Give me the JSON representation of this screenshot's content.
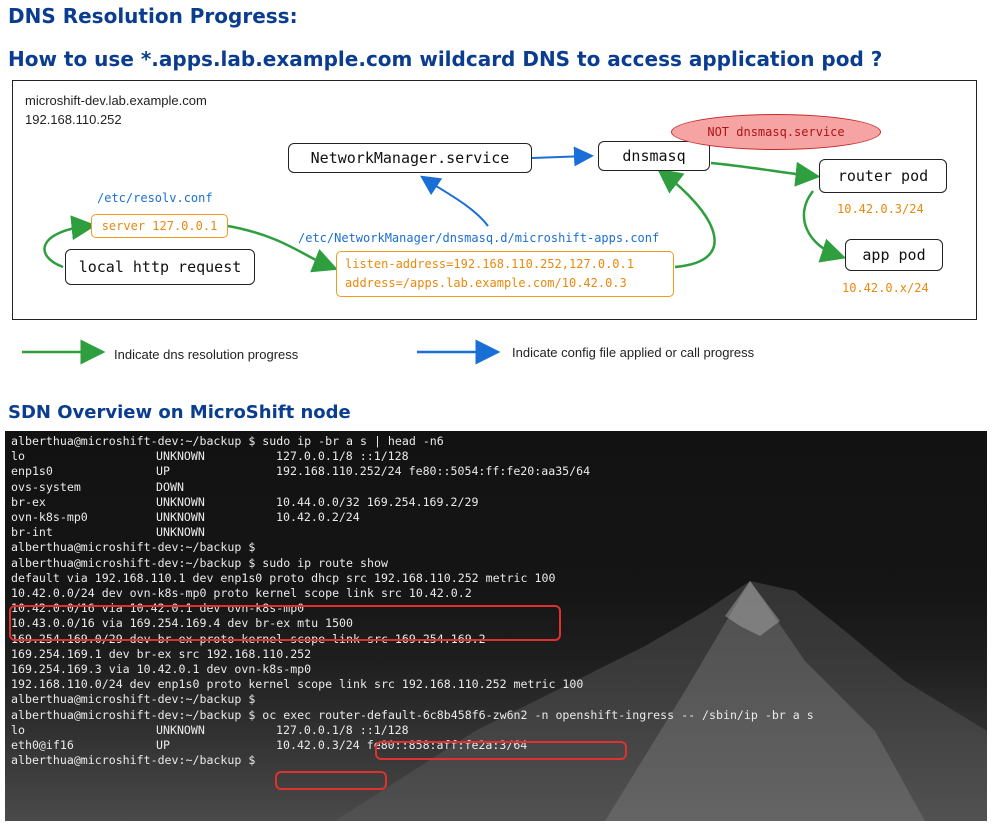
{
  "titles": {
    "main": "DNS Resolution Progress:",
    "question": "How to use *.apps.lab.example.com wildcard DNS to access application pod ?",
    "sdn": "SDN Overview on MicroShift node"
  },
  "diagram": {
    "host_name": "microshift-dev.lab.example.com",
    "host_ip": "192.168.110.252",
    "networkmanager": "NetworkManager.service",
    "dnsmasq": "dnsmasq",
    "not_service": "NOT dnsmasq.service",
    "router_pod": "router pod",
    "router_ip": "10.42.0.3/24",
    "app_pod": "app pod",
    "app_ip": "10.42.0.x/24",
    "resolv_path": "/etc/resolv.conf",
    "resolv_server": "server 127.0.0.1",
    "local_request": "local http request",
    "config_path": "/etc/NetworkManager/dnsmasq.d/microshift-apps.conf",
    "config_line1": "listen-address=192.168.110.252,127.0.0.1",
    "config_line2": "address=/apps.lab.example.com/10.42.0.3",
    "colors": {
      "dns_flow": "#2e9e3e",
      "config_flow": "#1a6fd6",
      "config_text": "#e8890c",
      "highlight": "#e03030"
    }
  },
  "legend": {
    "green": "Indicate dns resolution progress",
    "blue": "Indicate config file applied or call progress"
  },
  "terminal": {
    "lines": [
      {
        "c": [
          "alberthua@microshift-dev:~/backup $ sudo ip -br a s | head -n6"
        ]
      },
      {
        "c": [
          "lo",
          "UNKNOWN",
          "127.0.0.1/8 ::1/128"
        ]
      },
      {
        "c": [
          "enp1s0",
          "UP",
          "192.168.110.252/24 fe80::5054:ff:fe20:aa35/64"
        ]
      },
      {
        "c": [
          "ovs-system",
          "DOWN"
        ]
      },
      {
        "c": [
          "br-ex",
          "UNKNOWN",
          "10.44.0.0/32 169.254.169.2/29"
        ]
      },
      {
        "c": [
          "ovn-k8s-mp0",
          "UNKNOWN",
          "10.42.0.2/24"
        ]
      },
      {
        "c": [
          "br-int",
          "UNKNOWN"
        ]
      },
      {
        "c": [
          "alberthua@microshift-dev:~/backup $"
        ]
      },
      {
        "c": [
          "alberthua@microshift-dev:~/backup $ sudo ip route show"
        ]
      },
      {
        "c": [
          "default via 192.168.110.1 dev enp1s0 proto dhcp src 192.168.110.252 metric 100"
        ]
      },
      {
        "c": [
          "10.42.0.0/24 dev ovn-k8s-mp0 proto kernel scope link src 10.42.0.2"
        ]
      },
      {
        "c": [
          "10.42.0.0/16 via 10.42.0.1 dev ovn-k8s-mp0"
        ]
      },
      {
        "c": [
          "10.43.0.0/16 via 169.254.169.4 dev br-ex mtu 1500"
        ]
      },
      {
        "c": [
          "169.254.169.0/29 dev br-ex proto kernel scope link src 169.254.169.2"
        ]
      },
      {
        "c": [
          "169.254.169.1 dev br-ex src 192.168.110.252"
        ]
      },
      {
        "c": [
          "169.254.169.3 via 10.42.0.1 dev ovn-k8s-mp0"
        ]
      },
      {
        "c": [
          "192.168.110.0/24 dev enp1s0 proto kernel scope link src 192.168.110.252 metric 100"
        ]
      },
      {
        "c": [
          "alberthua@microshift-dev:~/backup $"
        ]
      },
      {
        "c": [
          "alberthua@microshift-dev:~/backup $ oc exec router-default-6c8b458f6-zw6n2 -n openshift-ingress -- /sbin/ip -br a s"
        ]
      },
      {
        "c": [
          "lo",
          "UNKNOWN",
          "127.0.0.1/8 ::1/128"
        ]
      },
      {
        "c": [
          "eth0@if16",
          "UP",
          "10.42.0.3/24 fe80::858:aff:fe2a:3/64"
        ]
      },
      {
        "c": [
          "alberthua@microshift-dev:~/backup $"
        ]
      }
    ]
  }
}
